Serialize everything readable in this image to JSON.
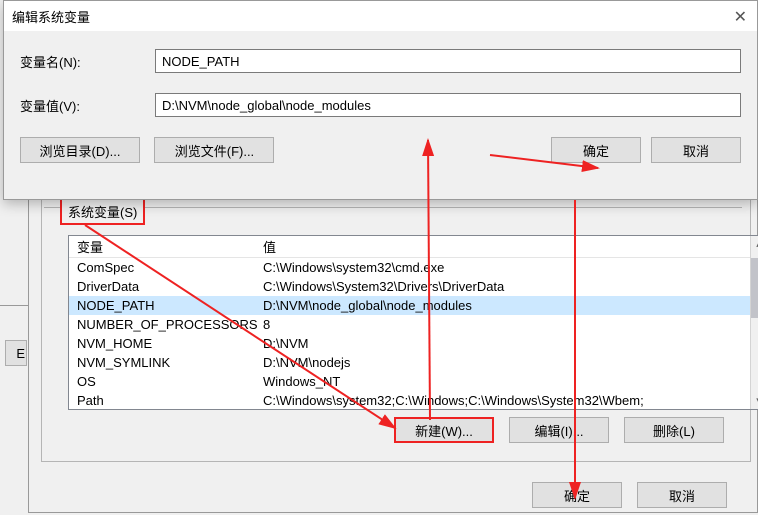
{
  "dialog": {
    "title": "编辑系统变量",
    "name_label": "变量名(N):",
    "name_value": "NODE_PATH",
    "value_label": "变量值(V):",
    "value_value": "D:\\NVM\\node_global\\node_modules",
    "browse_dir": "浏览目录(D)...",
    "browse_file": "浏览文件(F)...",
    "ok": "确定",
    "cancel": "取消"
  },
  "sysvar": {
    "group_label": "系统变量(S)",
    "col_var": "变量",
    "col_val": "值",
    "rows": [
      {
        "var": "ComSpec",
        "val": "C:\\Windows\\system32\\cmd.exe"
      },
      {
        "var": "DriverData",
        "val": "C:\\Windows\\System32\\Drivers\\DriverData"
      },
      {
        "var": "NODE_PATH",
        "val": "D:\\NVM\\node_global\\node_modules"
      },
      {
        "var": "NUMBER_OF_PROCESSORS",
        "val": "8"
      },
      {
        "var": "NVM_HOME",
        "val": "D:\\NVM"
      },
      {
        "var": "NVM_SYMLINK",
        "val": "D:\\NVM\\nodejs"
      },
      {
        "var": "OS",
        "val": "Windows_NT"
      },
      {
        "var": "Path",
        "val": "C:\\Windows\\system32;C:\\Windows;C:\\Windows\\System32\\Wbem;"
      }
    ],
    "new_btn": "新建(W)...",
    "edit_btn": "编辑(I)...",
    "delete_btn": "删除(L)"
  },
  "bottom": {
    "ok": "确定",
    "cancel": "取消"
  },
  "left_piece": "E"
}
